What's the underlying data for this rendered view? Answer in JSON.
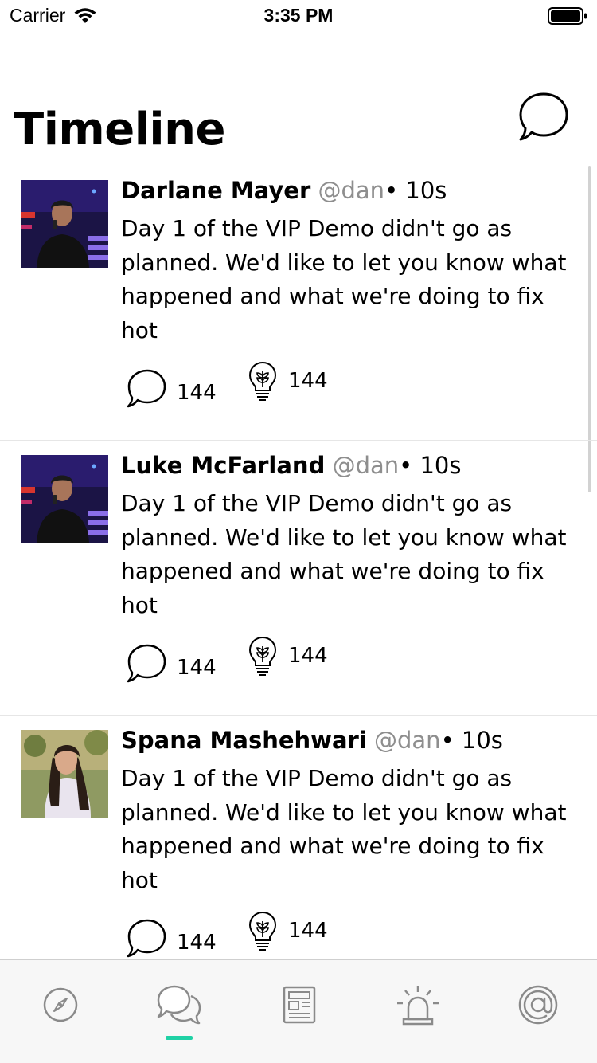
{
  "status_bar": {
    "carrier": "Carrier",
    "time": "3:35 PM"
  },
  "header": {
    "title": "Timeline",
    "compose_icon": "chat-bubble-icon"
  },
  "posts": [
    {
      "author": "Darlane Mayer",
      "handle": "@dan",
      "time": "• 10s",
      "body": "Day 1 of the VIP Demo didn't go as planned. We'd like to let you know what happened and what we're doing to fix hot",
      "reply_count": "144",
      "idea_count": "144",
      "avatar": "man-with-microphone"
    },
    {
      "author": "Luke McFarland",
      "handle": "@dan",
      "time": "• 10s",
      "body": "Day 1 of the VIP Demo didn't go as planned. We'd like to let you know what happened and what we're doing to fix hot",
      "reply_count": "144",
      "idea_count": "144",
      "avatar": "man-with-microphone"
    },
    {
      "author": "Spana Mashehwari",
      "handle": "@dan",
      "time": "• 10s",
      "body": "Day 1 of the VIP Demo didn't go as planned. We'd like to let you know what happened and what we're doing to fix hot",
      "reply_count": "144",
      "idea_count": "144",
      "avatar": "woman-portrait"
    }
  ],
  "tab_bar": {
    "tabs": [
      {
        "icon": "compass-icon",
        "active": false
      },
      {
        "icon": "chat-bubbles-icon",
        "active": true
      },
      {
        "icon": "news-icon",
        "active": false
      },
      {
        "icon": "alarm-light-icon",
        "active": false
      },
      {
        "icon": "at-sign-icon",
        "active": false
      }
    ],
    "accent_color": "#1fd1a5",
    "icon_color": "#8a8a8a"
  }
}
